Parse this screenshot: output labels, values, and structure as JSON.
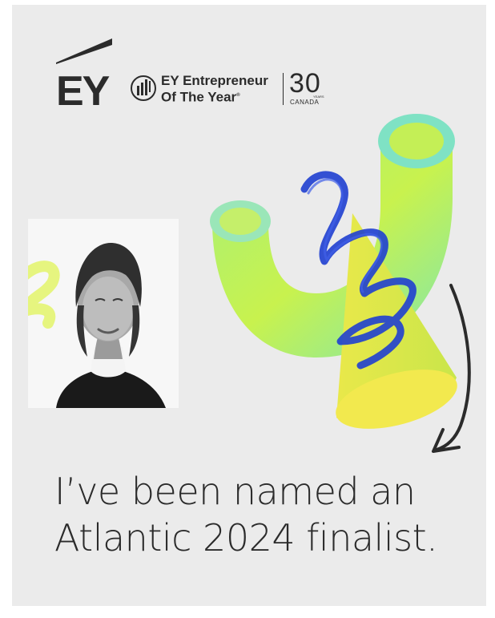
{
  "brand": {
    "logo_text": "EY",
    "program_line1": "EY Entrepreneur",
    "program_line2": "Of The Year",
    "program_mark": "®",
    "anniversary": "30",
    "anniversary_sub": "YEARS",
    "country": "CANADA"
  },
  "headline": {
    "line1": "I’ve been named an",
    "line2": "Atlantic 2024 finalist."
  },
  "colors": {
    "background": "#ebebeb",
    "text": "#2b2b2b",
    "tube_green": "#b8f04a",
    "tube_teal": "#6fe3c0",
    "cone_yellow": "#f2ee52",
    "scribble_blue": "#1f3fd0"
  }
}
